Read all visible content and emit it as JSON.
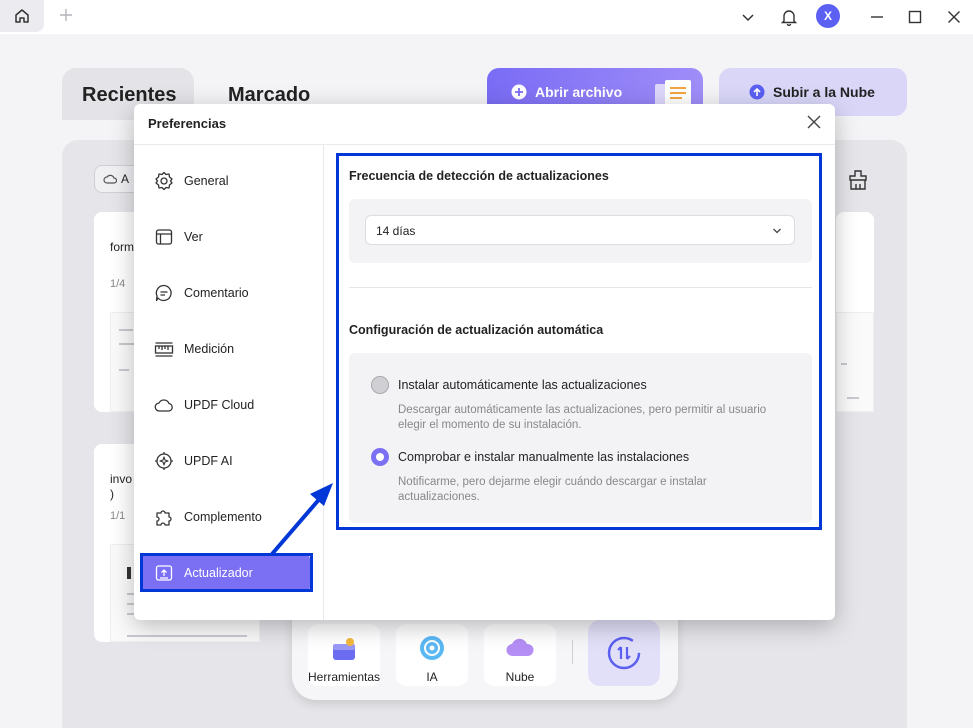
{
  "titlebar": {
    "avatar_letter": "X"
  },
  "background": {
    "tabs": [
      "Recientes",
      "Marcado"
    ],
    "open_file_label": "Abrir archivo",
    "upload_cloud_label": "Subir a la Nube",
    "chip_label": "A",
    "cards": [
      {
        "title": "form",
        "pages": "1/4"
      },
      {
        "title": "invo\n)",
        "pages": "1/1"
      }
    ],
    "bottom_bar": [
      "Herramientas",
      "IA",
      "Nube"
    ]
  },
  "dialog": {
    "title": "Preferencias",
    "sidebar": [
      {
        "label": "General",
        "icon": "gear-icon"
      },
      {
        "label": "Ver",
        "icon": "view-icon"
      },
      {
        "label": "Comentario",
        "icon": "comment-icon"
      },
      {
        "label": "Medición",
        "icon": "ruler-icon"
      },
      {
        "label": "UPDF Cloud",
        "icon": "cloud-icon"
      },
      {
        "label": "UPDF AI",
        "icon": "ai-icon"
      },
      {
        "label": "Complemento",
        "icon": "puzzle-icon"
      },
      {
        "label": "Actualizador",
        "icon": "upload-icon"
      }
    ],
    "active_item": "Actualizador",
    "frequency": {
      "title": "Frecuencia de detección de actualizaciones",
      "selected": "14 días"
    },
    "auto_update": {
      "title": "Configuración de actualización automática",
      "options": [
        {
          "label": "Instalar automáticamente las actualizaciones",
          "description": "Descargar automáticamente las actualizaciones, pero permitir al usuario elegir el momento de su instalación.",
          "selected": false
        },
        {
          "label": "Comprobar e instalar manualmente las instalaciones",
          "description": "Notificarme, pero dejarme elegir cuándo descargar e instalar actualizaciones.",
          "selected": true
        }
      ]
    }
  },
  "colors": {
    "accent": "#7b6ff3",
    "highlight": "#0037d6"
  }
}
